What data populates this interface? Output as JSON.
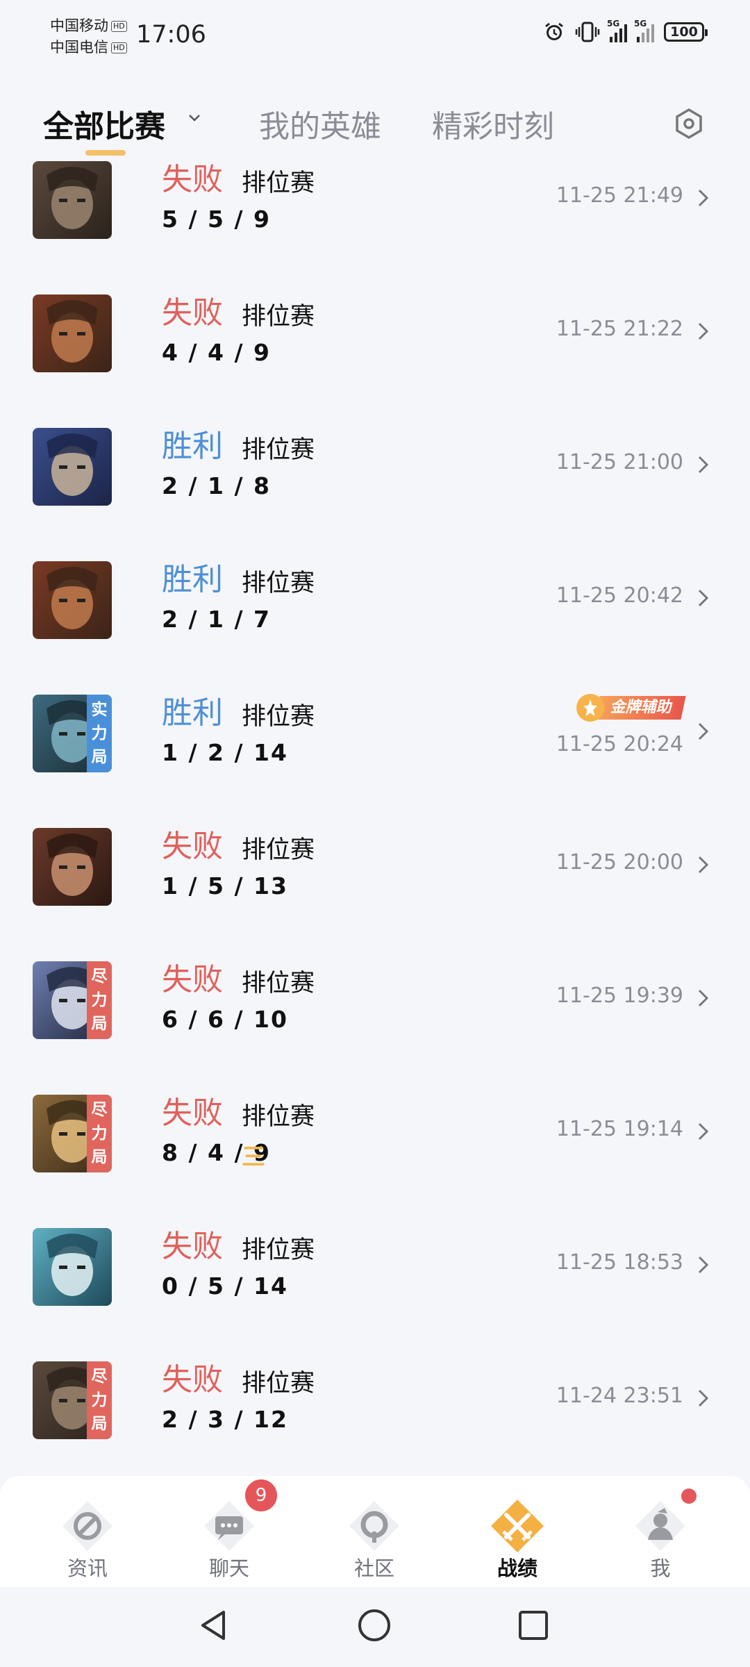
{
  "status_bar": {
    "carrier1": "中国移动",
    "carrier2": "中国电信",
    "hd": "HD",
    "time": "17:06",
    "net1": "5G",
    "net2": "5G",
    "battery": "100"
  },
  "tabs": [
    {
      "label": "全部比赛",
      "active": true
    },
    {
      "label": "我的英雄",
      "active": false
    },
    {
      "label": "精彩时刻",
      "active": false
    }
  ],
  "matches": [
    {
      "result": "失败",
      "win": false,
      "mode": "排位赛",
      "kda": "5 / 5 / 9",
      "time": "11-25 21:49",
      "hero": "beast-hero-portrait",
      "tag": null
    },
    {
      "result": "失败",
      "win": false,
      "mode": "排位赛",
      "kda": "4 / 4 / 9",
      "time": "11-25 21:22",
      "hero": "warrior-hero-portrait",
      "tag": null
    },
    {
      "result": "胜利",
      "win": true,
      "mode": "排位赛",
      "kda": "2 / 1 / 8",
      "time": "11-25 21:00",
      "hero": "swordsman-hero-portrait",
      "tag": null
    },
    {
      "result": "胜利",
      "win": true,
      "mode": "排位赛",
      "kda": "2 / 1 / 7",
      "time": "11-25 20:42",
      "hero": "warrior-hero-portrait",
      "tag": null
    },
    {
      "result": "胜利",
      "win": true,
      "mode": "排位赛",
      "kda": "1 / 2 / 14",
      "time": "11-25 20:24",
      "hero": "robot-hero-portrait",
      "tag": [
        "实",
        "力",
        "局"
      ],
      "tag_color": "blue",
      "award": "金牌辅助"
    },
    {
      "result": "失败",
      "win": false,
      "mode": "排位赛",
      "kda": "1 / 5 / 13",
      "time": "11-25 20:00",
      "hero": "rogue-hero-portrait",
      "tag": null
    },
    {
      "result": "失败",
      "win": false,
      "mode": "排位赛",
      "kda": "6 / 6 / 10",
      "time": "11-25 19:39",
      "hero": "mage-hero-portrait",
      "tag": [
        "尽",
        "力",
        "局"
      ],
      "tag_color": "red"
    },
    {
      "result": "失败",
      "win": false,
      "mode": "排位赛",
      "kda": "8 / 4 / 9",
      "time": "11-25 19:14",
      "hero": "golden-hero-portrait",
      "tag": [
        "尽",
        "力",
        "局"
      ],
      "tag_color": "red",
      "mvp_mark": "三"
    },
    {
      "result": "失败",
      "win": false,
      "mode": "排位赛",
      "kda": "0 / 5 / 14",
      "time": "11-25 18:53",
      "hero": "fairy-hero-portrait",
      "tag": null
    },
    {
      "result": "失败",
      "win": false,
      "mode": "排位赛",
      "kda": "2 / 3 / 12",
      "time": "11-24 23:51",
      "hero": "beast-hero-portrait",
      "tag": [
        "尽",
        "力",
        "局"
      ],
      "tag_color": "red"
    }
  ],
  "bottom_nav": [
    {
      "label": "资讯",
      "icon": "news-icon",
      "active": false
    },
    {
      "label": "聊天",
      "icon": "chat-icon",
      "active": false,
      "badge": "9"
    },
    {
      "label": "社区",
      "icon": "community-icon",
      "active": false
    },
    {
      "label": "战绩",
      "icon": "battle-record-icon",
      "active": true
    },
    {
      "label": "我",
      "icon": "profile-icon",
      "active": false,
      "dot": true
    }
  ],
  "colors": {
    "win": "#4d8fd6",
    "lose": "#e0605a",
    "accent": "#f4b042",
    "background": "#f5f6fa"
  }
}
